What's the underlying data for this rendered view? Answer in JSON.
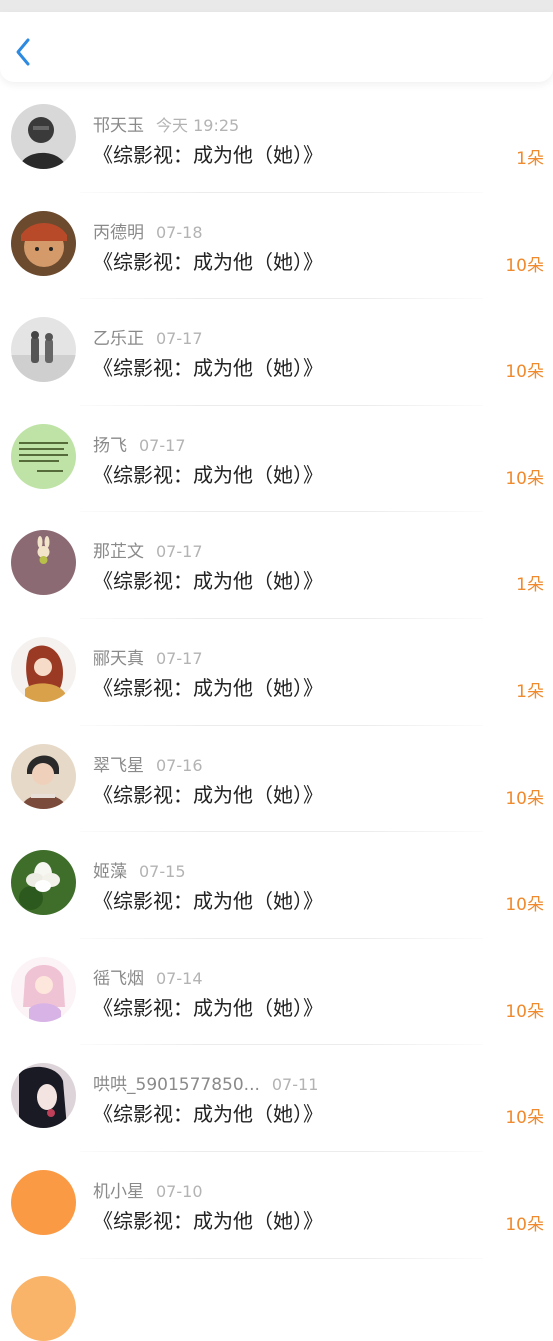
{
  "header": {
    "back_icon": "chevron-left-icon",
    "accent": "#2d8ae0"
  },
  "colors": {
    "count": "#f08a2e",
    "name": "#8a8a8a",
    "date": "#b3b3b3",
    "title": "#222222"
  },
  "rows": [
    {
      "name": "邗天玉",
      "date": "今天 19:25",
      "title": "《综影视：成为他（她）》",
      "count": "1朵",
      "avatar": "dark-portrait"
    },
    {
      "name": "丙德明",
      "date": "07-18",
      "title": "《综影视：成为他（她）》",
      "count": "10朵",
      "avatar": "man-bandana"
    },
    {
      "name": "乙乐正",
      "date": "07-17",
      "title": "《综影视：成为他（她）》",
      "count": "10朵",
      "avatar": "couple-walking"
    },
    {
      "name": "扬飞",
      "date": "07-17",
      "title": "《综影视：成为他（她）》",
      "count": "10朵",
      "avatar": "text-quote"
    },
    {
      "name": "那芷文",
      "date": "07-17",
      "title": "《综影视：成为他（她）》",
      "count": "1朵",
      "avatar": "bunny-mauve"
    },
    {
      "name": "郦天真",
      "date": "07-17",
      "title": "《综影视：成为他（她）》",
      "count": "1朵",
      "avatar": "anime-girl-red"
    },
    {
      "name": "翠飞星",
      "date": "07-16",
      "title": "《综影视：成为他（她）》",
      "count": "10朵",
      "avatar": "boy-portrait"
    },
    {
      "name": "姬藻",
      "date": "07-15",
      "title": "《综影视：成为他（她）》",
      "count": "10朵",
      "avatar": "white-flower"
    },
    {
      "name": "徭飞烟",
      "date": "07-14",
      "title": "《综影视：成为他（她）》",
      "count": "10朵",
      "avatar": "anime-girl-pink"
    },
    {
      "name": "哄哄_5901577850...",
      "date": "07-11",
      "title": "《综影视：成为他（她）》",
      "count": "10朵",
      "avatar": "dark-hair-girl"
    },
    {
      "name": "机小星",
      "date": "07-10",
      "title": "《综影视：成为他（她）》",
      "count": "10朵",
      "avatar": "orange-solid"
    }
  ]
}
